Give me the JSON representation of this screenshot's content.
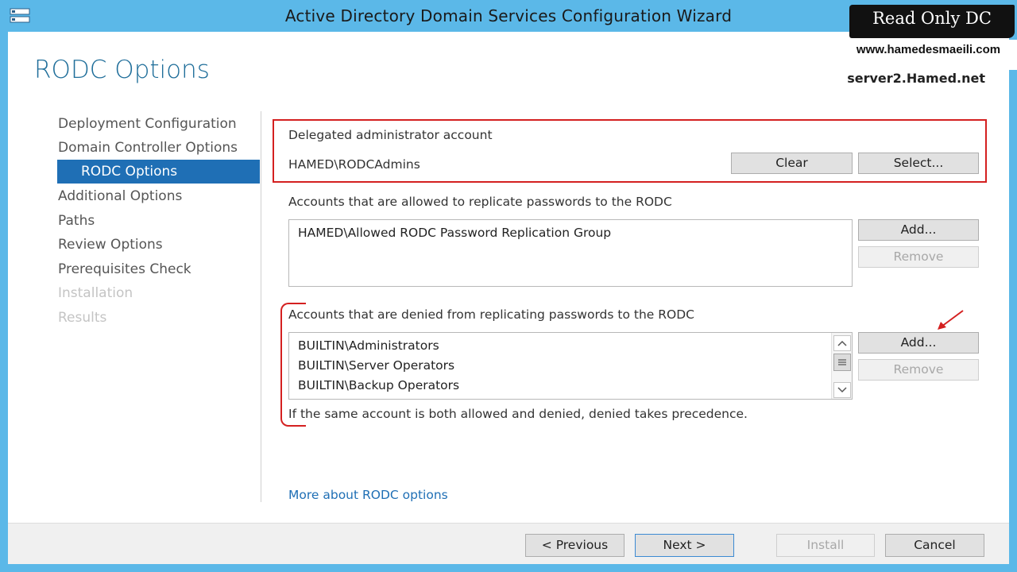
{
  "window": {
    "title": "Active Directory Domain Services Configuration Wizard"
  },
  "header": {
    "page_title": "RODC Options",
    "server": "server2.Hamed.net"
  },
  "nav": {
    "items": [
      {
        "label": "Deployment Configuration",
        "state": "normal"
      },
      {
        "label": "Domain Controller Options",
        "state": "normal"
      },
      {
        "label": "RODC Options",
        "state": "selected"
      },
      {
        "label": "Additional Options",
        "state": "normal"
      },
      {
        "label": "Paths",
        "state": "normal"
      },
      {
        "label": "Review Options",
        "state": "normal"
      },
      {
        "label": "Prerequisites Check",
        "state": "normal"
      },
      {
        "label": "Installation",
        "state": "disabled"
      },
      {
        "label": "Results",
        "state": "disabled"
      }
    ]
  },
  "delegated": {
    "label": "Delegated administrator account",
    "value": "HAMED\\RODCAdmins",
    "clear_label": "Clear",
    "select_label": "Select..."
  },
  "allowed": {
    "label": "Accounts that are allowed to replicate passwords to the RODC",
    "items": [
      "HAMED\\Allowed RODC Password Replication Group"
    ],
    "add_label": "Add...",
    "remove_label": "Remove"
  },
  "denied": {
    "label": "Accounts that are denied from replicating passwords to the RODC",
    "items": [
      "BUILTIN\\Administrators",
      "BUILTIN\\Server Operators",
      "BUILTIN\\Backup Operators"
    ],
    "add_label": "Add...",
    "remove_label": "Remove",
    "note": "If the same account is both allowed and denied, denied takes precedence."
  },
  "more_link": "More about RODC options",
  "footer": {
    "previous_label": "< Previous",
    "next_label": "Next >",
    "install_label": "Install",
    "cancel_label": "Cancel"
  },
  "watermark": {
    "title": "Read Only DC",
    "url": "www.hamedesmaeili.com"
  },
  "colors": {
    "accent": "#1f6fb5",
    "titlebar": "#5bb8e8",
    "annotation": "#d42020",
    "title": "#1f6e9a"
  },
  "icons": {
    "app": "server-manager-icon",
    "scroll_up": "chevron-up-icon",
    "scroll_down": "chevron-down-icon",
    "annotation": "red-arrow-icon"
  }
}
